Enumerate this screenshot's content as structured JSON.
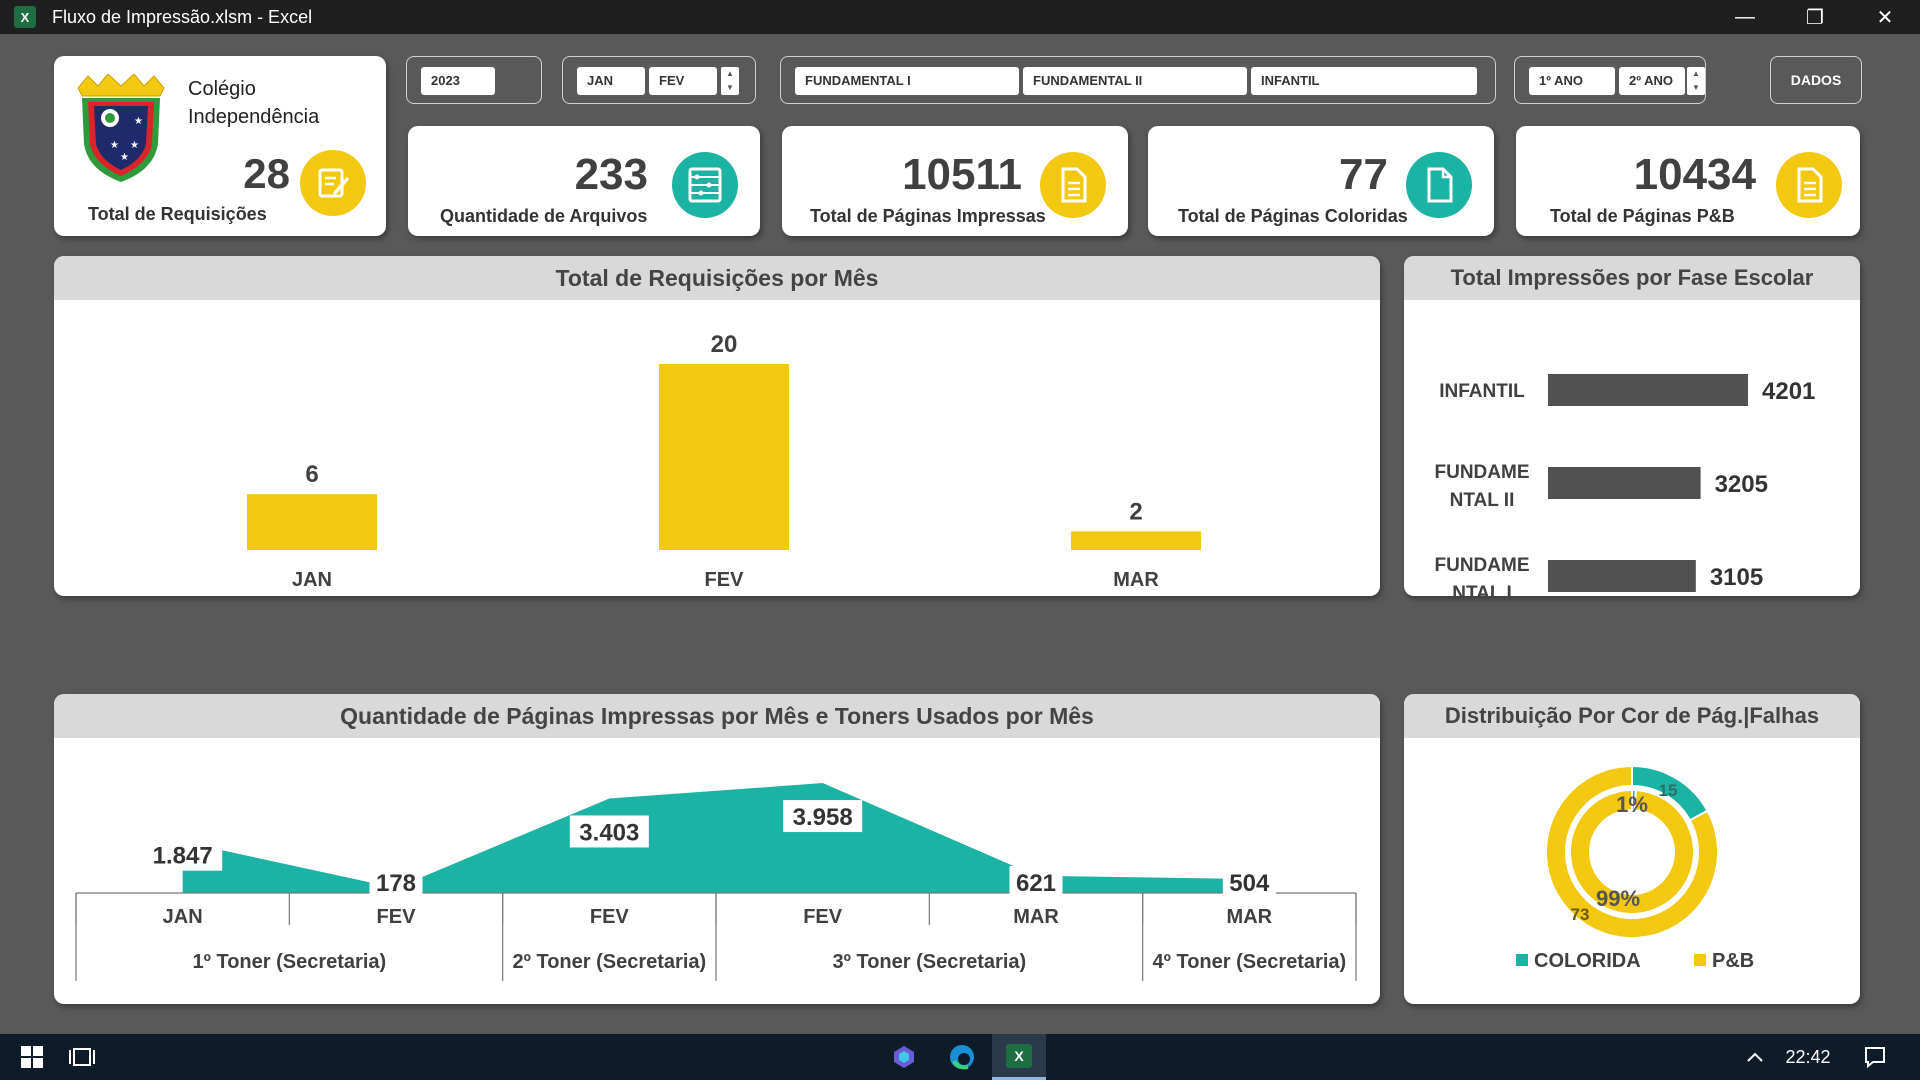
{
  "window": {
    "app_icon_letter": "X",
    "title": "Fluxo de Impressão.xlsm - Excel",
    "minimize_glyph": "—",
    "restore_glyph": "❐",
    "close_glyph": "✕"
  },
  "school": {
    "name_line1": "Colégio",
    "name_line2": "Independência"
  },
  "filters": {
    "year": "2023",
    "months": [
      "JAN",
      "FEV"
    ],
    "phases": [
      "FUNDAMENTAL I",
      "FUNDAMENTAL II",
      "INFANTIL"
    ],
    "grades": [
      "1º ANO",
      "2º ANO"
    ],
    "dados_label": "DADOS"
  },
  "kpis": {
    "requisicoes": {
      "value": "28",
      "label": "Total de Requisições",
      "icon": "edit-note-icon"
    },
    "arquivos": {
      "value": "233",
      "label": "Quantidade de Arquivos",
      "icon": "abacus-icon"
    },
    "impressas": {
      "value": "10511",
      "label": "Total de Páginas Impressas",
      "icon": "document-icon"
    },
    "coloridas": {
      "value": "77",
      "label": "Total de Páginas Coloridas",
      "icon": "blank-page-icon"
    },
    "pb": {
      "value": "10434",
      "label": "Total de Páginas P&B",
      "icon": "document-icon"
    }
  },
  "colors": {
    "yellow": "#F2C811",
    "teal": "#1BB3A4",
    "dark_bar": "#505050",
    "panel_bg": "#595959",
    "title_gray": "#D9D9D9"
  },
  "monthly_panel": {
    "title": "Total de Requisições por Mês",
    "chart_data": {
      "type": "bar",
      "categories": [
        "JAN",
        "FEV",
        "MAR"
      ],
      "values": [
        6,
        20,
        2
      ],
      "ylim": [
        0,
        20
      ],
      "grid": false,
      "data_labels": true
    }
  },
  "phase_panel": {
    "title": "Total Impressões por Fase Escolar",
    "chart_data": {
      "type": "bar",
      "orientation": "horizontal",
      "categories": [
        "INFANTIL",
        "FUNDAME NTAL II",
        "FUNDAME NTAL I"
      ],
      "values": [
        4201,
        3205,
        3105
      ],
      "grid": false,
      "data_labels": true
    }
  },
  "toner_panel": {
    "title": "Quantidade de Páginas Impressas por Mês e Toners Usados por Mês",
    "chart_data": {
      "type": "area",
      "categories": [
        "JAN",
        "FEV",
        "FEV",
        "FEV",
        "MAR",
        "MAR"
      ],
      "groups": [
        {
          "label": "1º Toner (Secretaria)",
          "span": 2
        },
        {
          "label": "2º Toner (Secretaria)",
          "span": 1
        },
        {
          "label": "3º Toner (Secretaria)",
          "span": 2
        },
        {
          "label": "4º Toner (Secretaria)",
          "span": 1
        }
      ],
      "values": [
        1847,
        178,
        3403,
        3958,
        621,
        504
      ],
      "value_labels": [
        "1.847",
        "178",
        "3.403",
        "3.958",
        "621",
        "504"
      ],
      "ylim": [
        0,
        4500
      ],
      "grid": false
    }
  },
  "dist_panel": {
    "title": "Distribuição Por Cor de Pág.|Falhas",
    "chart_data": {
      "type": "pie",
      "style": "double-donut",
      "outer": {
        "labels": [
          "COLORIDA",
          "P&B"
        ],
        "values": [
          15,
          73
        ]
      },
      "inner": {
        "labels": [
          "COLORIDA",
          "P&B"
        ],
        "values": [
          1,
          99
        ],
        "value_labels": [
          "1%",
          "99%"
        ]
      },
      "legend": [
        "COLORIDA",
        "P&B"
      ],
      "legend_position": "bottom"
    }
  },
  "taskbar": {
    "clock": "22:42"
  }
}
